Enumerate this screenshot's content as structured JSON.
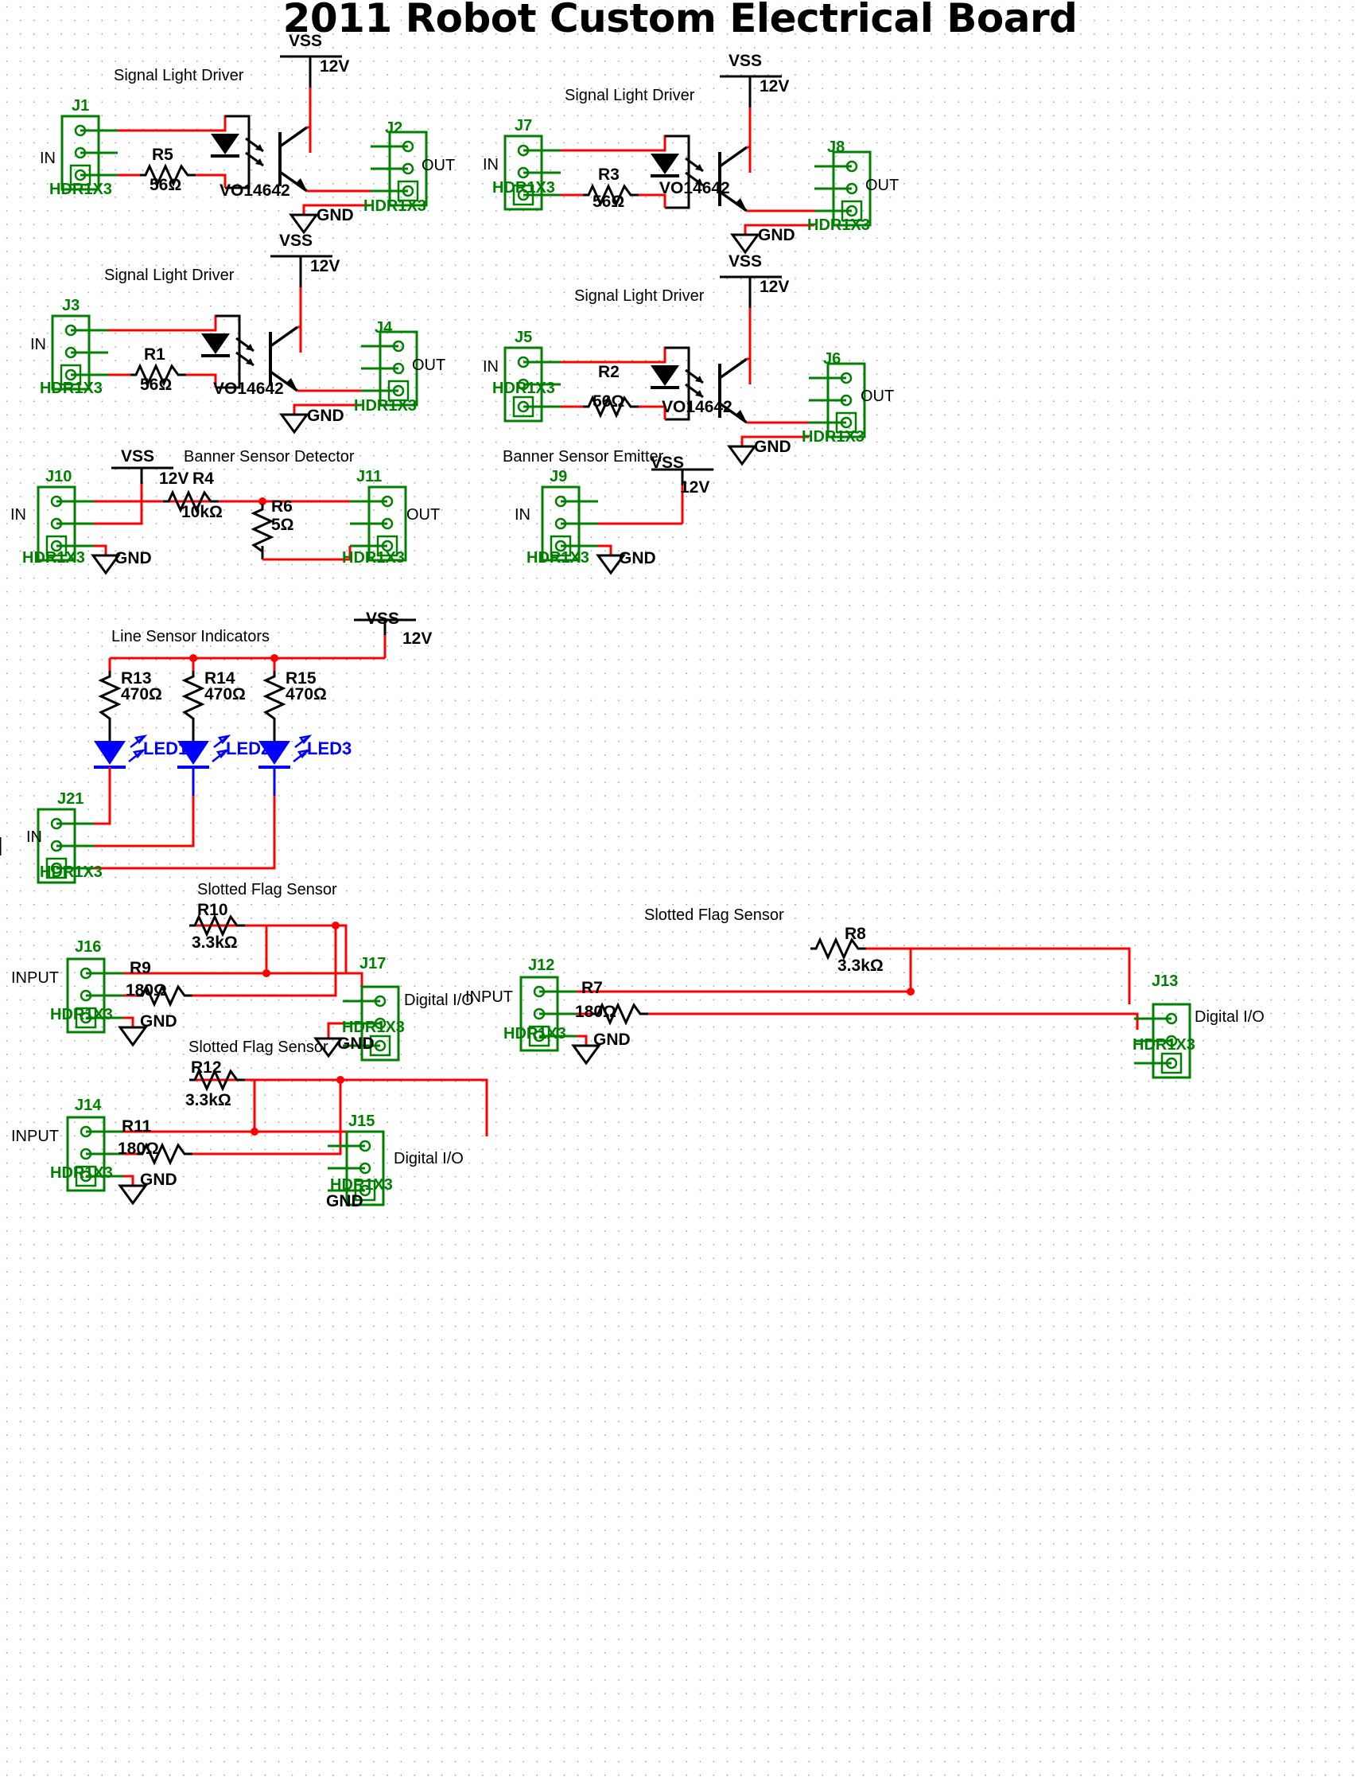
{
  "title": "2011 Robot Custom Electrical Board",
  "labels": {
    "section_signal": "Signal Light Driver",
    "section_banner_det": "Banner Sensor Detector",
    "section_banner_emit": "Banner Sensor Emitter",
    "section_line": "Line Sensor Indicators",
    "section_slot": "Slotted Flag Sensor",
    "in": "IN",
    "out": "OUT",
    "input": "INPUT",
    "digital_io": "Digital I/O",
    "vss": "VSS",
    "v12": "12V",
    "gnd": "GND",
    "hdr": "HDR1X3",
    "opto": "VO14642"
  },
  "colors": {
    "wire_red": "#ff0000",
    "wire_black": "#000000",
    "connector_green": "#008000",
    "led_blue": "#0000ff",
    "text_black": "#000000"
  },
  "blocks": {
    "signal_drivers": [
      {
        "in_conn": "J1",
        "out_conn": "J2",
        "resistor": "R5",
        "value": "56Ω",
        "opto": "VO14642"
      },
      {
        "in_conn": "J7",
        "out_conn": "J8",
        "resistor": "R3",
        "value": "56Ω",
        "opto": "VO14642"
      },
      {
        "in_conn": "J3",
        "out_conn": "J4",
        "resistor": "R1",
        "value": "56Ω",
        "opto": "VO14642"
      },
      {
        "in_conn": "J5",
        "out_conn": "J6",
        "resistor": "R2",
        "value": "56Ω",
        "opto": "VO14642"
      }
    ],
    "banner_detector": {
      "in_conn": "J10",
      "out_conn": "J11",
      "series_resistor": "R4",
      "series_value": "10kΩ",
      "shunt_resistor": "R6",
      "shunt_value": "5Ω"
    },
    "banner_emitter": {
      "in_conn": "J9"
    },
    "line_sensor": {
      "in_conn": "J21",
      "resistors": [
        {
          "ref": "R13",
          "value": "470Ω",
          "led": "LED1"
        },
        {
          "ref": "R14",
          "value": "470Ω",
          "led": "LED2"
        },
        {
          "ref": "R15",
          "value": "470Ω",
          "led": "LED3"
        }
      ]
    },
    "slotted_flag": [
      {
        "in_conn": "J16",
        "out_conn": "J17",
        "pullup": "R10",
        "pullup_value": "3.3kΩ",
        "series": "R9",
        "series_value": "180Ω"
      },
      {
        "in_conn": "J12",
        "out_conn": "J13",
        "pullup": "R8",
        "pullup_value": "3.3kΩ",
        "series": "R7",
        "series_value": "180Ω"
      },
      {
        "in_conn": "J14",
        "out_conn": "J15",
        "pullup": "R12",
        "pullup_value": "3.3kΩ",
        "series": "R11",
        "series_value": "180Ω"
      }
    ]
  }
}
